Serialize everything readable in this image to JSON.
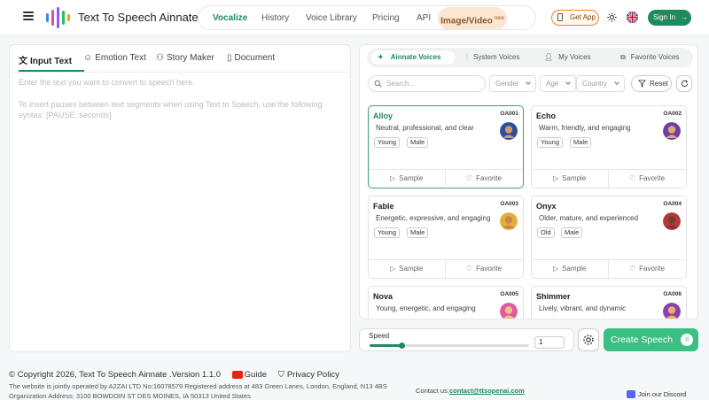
{
  "header": {
    "brand": "Text To Speech Ainnate",
    "nav": [
      "Vocalize",
      "History",
      "Voice Library",
      "Pricing",
      "API"
    ],
    "image_video": "Image/Video",
    "image_video_badge": "new",
    "get_app": "Get App",
    "sign_in": "Sign In"
  },
  "input_tabs": [
    "Input Text",
    "Emotion Text",
    "Story Maker",
    "Document"
  ],
  "editor": {
    "placeholder_1": "Enter the text you want to convert to speech here.",
    "placeholder_2": "To insert pauses between text segments when using Text to Speech, use the following syntax: [PAUSE::seconds]"
  },
  "voice_tabs": [
    "Ainnate Voices",
    "System Voices",
    "My Voices",
    "Favorite Voices"
  ],
  "filters": {
    "search_placeholder": "Search...",
    "gender": "Gender",
    "age": "Age",
    "country": "Country",
    "reset": "Reset"
  },
  "voices": [
    {
      "name": "Alloy",
      "code": "OA001",
      "desc": "Neutral, professional, and clear",
      "tags": [
        "Young",
        "Male"
      ],
      "avatar": "#2a4f9e",
      "skin": "#d49a6a"
    },
    {
      "name": "Echo",
      "code": "OA002",
      "desc": "Warm, friendly, and engaging",
      "tags": [
        "Young",
        "Male"
      ],
      "avatar": "#6a3fa0",
      "skin": "#e0a77a"
    },
    {
      "name": "Fable",
      "code": "OA003",
      "desc": "Energetic, expressive, and engaging",
      "tags": [
        "Young",
        "Male"
      ],
      "avatar": "#e2b03a",
      "skin": "#c88550"
    },
    {
      "name": "Onyx",
      "code": "OA004",
      "desc": "Older, mature, and experienced",
      "tags": [
        "Old",
        "Male"
      ],
      "avatar": "#b33a3a",
      "skin": "#7a3a2a"
    },
    {
      "name": "Nova",
      "code": "OA005",
      "desc": "Young, energetic, and engaging",
      "tags": [],
      "avatar": "#e05aa0",
      "skin": "#f0c090"
    },
    {
      "name": "Shimmer",
      "code": "OA006",
      "desc": "Lively, vibrant, and dynamic",
      "tags": [],
      "avatar": "#8a3fb0",
      "skin": "#e8b070"
    }
  ],
  "card_actions": {
    "sample": "Sample",
    "favorite": "Favorite"
  },
  "speed": {
    "label": "Speed",
    "value": "1",
    "level": 0.2
  },
  "create_button": "Create Speech",
  "footer": {
    "copyright": "© Copyright 2026, Text To Speech Ainnate .Version 1.1.0",
    "guide": "Guide",
    "privacy": "Privacy Policy",
    "company": "The website is jointly operated by A2ZAI LTD No:16078579 Registered address at 483 Green Lanes, London, England, N13 4BS",
    "org_address": "Organization Address: 3100 BOWDOIN ST DES MOINES, IA 50313 United States",
    "contact_label": "Contact us:",
    "contact_email": "contact@ttsopenai.com",
    "discord": "Join our Discord"
  },
  "colors": {
    "accent": "#1f8a5b",
    "create": "#3cbf83",
    "image_video_bg": "#fbe6d2"
  }
}
